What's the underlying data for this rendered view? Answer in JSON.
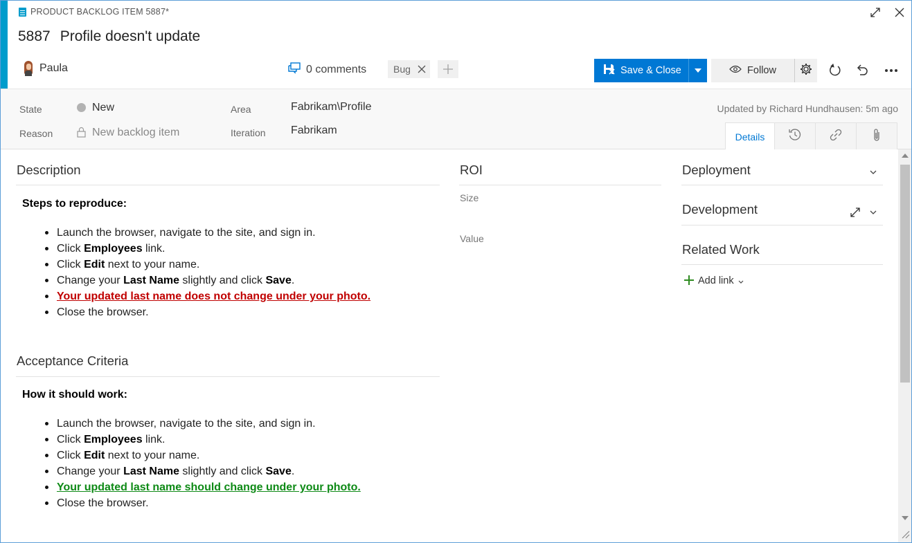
{
  "header": {
    "type_label": "PRODUCT BACKLOG ITEM 5887*",
    "id": "5887",
    "title": "Profile doesn't update",
    "assignee": "Paula",
    "comments_label": "0 comments",
    "tag": "Bug",
    "save_close_label": "Save & Close",
    "follow_label": "Follow"
  },
  "fields": {
    "state_label": "State",
    "state_value": "New",
    "reason_label": "Reason",
    "reason_value": "New backlog item",
    "area_label": "Area",
    "area_value": "Fabrikam\\Profile",
    "iteration_label": "Iteration",
    "iteration_value": "Fabrikam",
    "updated": "Updated by Richard Hundhausen: 5m ago",
    "details_tab": "Details"
  },
  "description": {
    "heading": "Description",
    "subheading": "Steps to reproduce:",
    "steps": [
      {
        "pre": "Launch the browser, navigate to the site, and sign in."
      },
      {
        "pre": "Click ",
        "b1": "Employees",
        "post": " link."
      },
      {
        "pre": "Click ",
        "b1": "Edit",
        "post": " next to your name."
      },
      {
        "pre": "Change your ",
        "b1": "Last Name",
        "mid": " slightly and click ",
        "b2": "Save",
        "post": "."
      },
      {
        "link": "Your updated last name does not change under your photo."
      },
      {
        "pre": "Close the browser."
      }
    ]
  },
  "acceptance": {
    "heading": "Acceptance Criteria",
    "subheading": "How it should work:",
    "steps": [
      {
        "pre": "Launch the browser, navigate to the site, and sign in."
      },
      {
        "pre": "Click ",
        "b1": "Employees",
        "post": " link."
      },
      {
        "pre": "Click ",
        "b1": "Edit",
        "post": " next to your name."
      },
      {
        "pre": "Change your ",
        "b1": "Last Name",
        "mid": " slightly and click ",
        "b2": "Save",
        "post": "."
      },
      {
        "link": "Your updated last name should change under your photo."
      },
      {
        "pre": "Close the browser."
      }
    ]
  },
  "roi": {
    "heading": "ROI",
    "size_label": "Size",
    "value_label": "Value"
  },
  "right": {
    "deployment": "Deployment",
    "development": "Development",
    "related_work": "Related Work",
    "add_link": "Add link"
  },
  "colors": {
    "accent": "#009ccc",
    "primary": "#0078d4",
    "bad": "#c00000",
    "good": "#0e8a16"
  }
}
